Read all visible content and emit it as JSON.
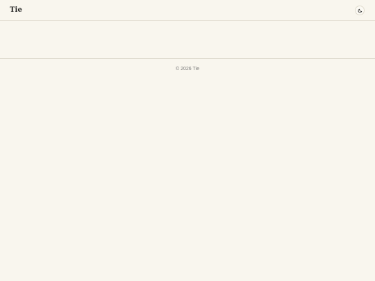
{
  "header": {
    "brand": "Tie",
    "theme_toggle_icon": "moon-icon"
  },
  "footer": {
    "copyright": "© 2026 Tie"
  },
  "colors": {
    "background": "#f9f6ee",
    "text": "#262626",
    "muted_text": "#7a7a7a",
    "border": "#dcd7cb"
  }
}
